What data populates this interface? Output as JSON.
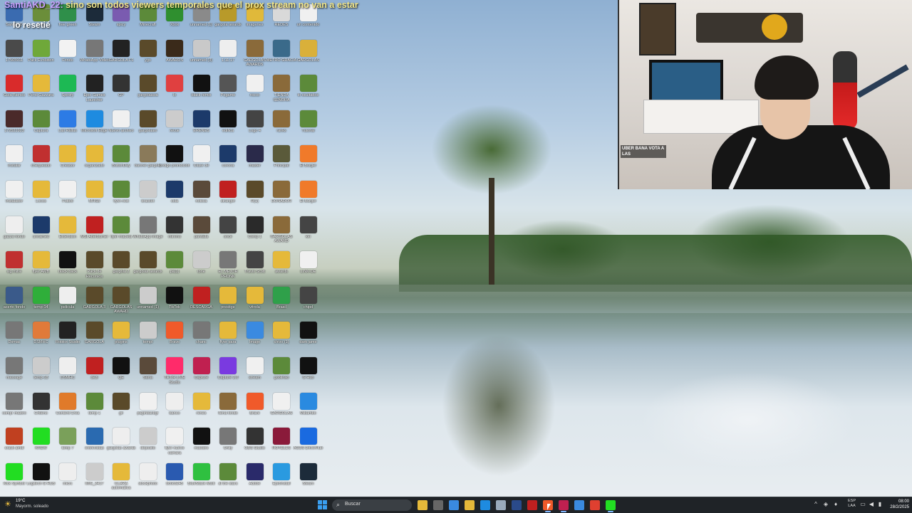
{
  "chat": {
    "line_user": "SantiAKD_22:",
    "line_text": "sino son todos viewers temporales que el prox stream no van a estar",
    "second_line": "lo resetié"
  },
  "desktop_icons": [
    {
      "label": "SantiAKD",
      "color": "#3a6bb0"
    },
    {
      "label": "Pack",
      "color": "#6b8e3a"
    },
    {
      "label": "free green",
      "color": "#2f8f4a"
    },
    {
      "label": "Steam",
      "color": "#1c2b3a"
    },
    {
      "label": "spicy",
      "color": "#7a5bb0"
    },
    {
      "label": "Minecraft",
      "color": "#5c8a3a"
    },
    {
      "label": "Xbox",
      "color": "#2f8f2f"
    },
    {
      "label": "unnamed (1)",
      "color": "#8a8a8a"
    },
    {
      "label": "gargola awards",
      "color": "#b89a2a"
    },
    {
      "label": "imagenes",
      "color": "#e0b93a"
    },
    {
      "label": "REDES",
      "color": "#d9d9d9"
    },
    {
      "label": "un contenido",
      "color": "#f0f0f0"
    },
    {
      "label": "17565911",
      "color": "#4a4a4a"
    },
    {
      "label": "Pack Evolution",
      "color": "#6fa83a"
    },
    {
      "label": "Fondo",
      "color": "#f2f2f2"
    },
    {
      "label": "WhatsApp Video",
      "color": "#777"
    },
    {
      "label": "GARGOLA F1",
      "color": "#222"
    },
    {
      "label": "ygo",
      "color": "#5a4a2a"
    },
    {
      "label": "AWARDS",
      "color": "#3a2a1a"
    },
    {
      "label": "unnamed (3)",
      "color": "#c9c9c9"
    },
    {
      "label": "1.11.17",
      "color": "#eee"
    },
    {
      "label": "GARGOLAS AWARDS",
      "color": "#8a6a3a"
    },
    {
      "label": "METRO GRACIA",
      "color": "#3a6a8a"
    },
    {
      "label": "GARGOLAS",
      "color": "#d9b03a"
    },
    {
      "label": "Guia Bienes",
      "color": "#d92b2b"
    },
    {
      "label": "Perdi Gazzara",
      "color": "#e5b93a"
    },
    {
      "label": "Spotify",
      "color": "#1db954"
    },
    {
      "label": "Epic Games Launcher",
      "color": "#222"
    },
    {
      "label": "GP",
      "color": "#333"
    },
    {
      "label": "gargolaawa",
      "color": "#5a4a2a"
    },
    {
      "label": "lo",
      "color": "#e04040"
    },
    {
      "label": "black remix",
      "color": "#111"
    },
    {
      "label": "Pegame",
      "color": "#555"
    },
    {
      "label": "rocco",
      "color": "#f0f0f0"
    },
    {
      "label": "TIENDA SEÑORA",
      "color": "#8a6a3a"
    },
    {
      "label": "lo ocultados",
      "color": "#5c8a3a"
    },
    {
      "label": "172521923",
      "color": "#4a2a2a"
    },
    {
      "label": "Captura",
      "color": "#5c8a3a"
    },
    {
      "label": "Las Rallas",
      "color": "#2c7be5"
    },
    {
      "label": "Microsoft Edge",
      "color": "#1e8be0"
    },
    {
      "label": "Nuevo archivo",
      "color": "#f0f0f0"
    },
    {
      "label": "gargolaaw",
      "color": "#5a4a2a"
    },
    {
      "label": "revue",
      "color": "#ccc"
    },
    {
      "label": "ERENES",
      "color": "#1c3a6a"
    },
    {
      "label": "edifica",
      "color": "#111"
    },
    {
      "label": "Logo 4",
      "color": "#444"
    },
    {
      "label": "ranks",
      "color": "#8a6a3a"
    },
    {
      "label": "Tutorial",
      "color": "#5c8a3a"
    },
    {
      "label": "Instalar",
      "color": "#f0f0f0"
    },
    {
      "label": "chequeado",
      "color": "#c03030"
    },
    {
      "label": "Creador",
      "color": "#e5b93a"
    },
    {
      "label": "organizado",
      "color": "#e5b93a"
    },
    {
      "label": "ButtonDay",
      "color": "#5c8a3a"
    },
    {
      "label": "banner gargola",
      "color": "#8a7a5a"
    },
    {
      "label": "codigo promocion",
      "color": "#111"
    },
    {
      "label": "Clase de",
      "color": "#f0f0f0"
    },
    {
      "label": "corona",
      "color": "#1c3a6a"
    },
    {
      "label": "master",
      "color": "#2a2a4a"
    },
    {
      "label": "Principal",
      "color": "#5a5a3a"
    },
    {
      "label": "El Burger",
      "color": "#f07a2a"
    },
    {
      "label": "Instalador",
      "color": "#f0f0f0"
    },
    {
      "label": "Locos",
      "color": "#e5b93a"
    },
    {
      "label": "Futbol",
      "color": "#f0f0f0"
    },
    {
      "label": "MHSB",
      "color": "#e5b93a"
    },
    {
      "label": "flyer-rest",
      "color": "#5c8a3a"
    },
    {
      "label": "bracket",
      "color": "#ccc"
    },
    {
      "label": "cola",
      "color": "#1c3a6a"
    },
    {
      "label": "noticia",
      "color": "#5a4a3a"
    },
    {
      "label": "stranger",
      "color": "#c02020"
    },
    {
      "label": "R(1)",
      "color": "#5a4a2a"
    },
    {
      "label": "DONADOR",
      "color": "#8a6a3a"
    },
    {
      "label": "El Burger",
      "color": "#f07a2a"
    },
    {
      "label": "gazza fondo",
      "color": "#eee"
    },
    {
      "label": "unnamed",
      "color": "#1c3a6a"
    },
    {
      "label": "Extension",
      "color": "#e5b93a"
    },
    {
      "label": "MSI Afterburner",
      "color": "#c02020"
    },
    {
      "label": "flyer maceta",
      "color": "#5c8a3a"
    },
    {
      "label": "WhatsApp Image",
      "color": "#777"
    },
    {
      "label": "mimmo",
      "color": "#333"
    },
    {
      "label": "pantalla",
      "color": "#5a4a3a"
    },
    {
      "label": "once",
      "color": "#444"
    },
    {
      "label": "Comp 1",
      "color": "#2a2a2a"
    },
    {
      "label": "GARGOLAS AWARD",
      "color": "#8a6a3a"
    },
    {
      "label": "kei",
      "color": "#444"
    },
    {
      "label": "sig mitre",
      "color": "#c03030"
    },
    {
      "label": "flyer AMB",
      "color": "#e5b93a"
    },
    {
      "label": "black back",
      "color": "#111"
    },
    {
      "label": "Pack de Recursos",
      "color": "#5a4a2a"
    },
    {
      "label": "gargola 2",
      "color": "#5a4a2a"
    },
    {
      "label": "gargolas awards",
      "color": "#5a4a2a"
    },
    {
      "label": "pa(1)",
      "color": "#5c8a3a"
    },
    {
      "label": "tone",
      "color": "#ccc"
    },
    {
      "label": "EL MEJOR PHONK",
      "color": "#777"
    },
    {
      "label": "Travis Scott",
      "color": "#444"
    },
    {
      "label": "awards",
      "color": "#e5b93a"
    },
    {
      "label": "LINK-DE",
      "color": "#f0f0f0"
    },
    {
      "label": "acerto fondo",
      "color": "#3a5a8a"
    },
    {
      "label": "temp-14",
      "color": "#2fae3a"
    },
    {
      "label": "pelicula",
      "color": "#eee"
    },
    {
      "label": "GARGOLA 3",
      "color": "#5a4a2a"
    },
    {
      "label": "GARGOLAS AWARD",
      "color": "#5a4a2a"
    },
    {
      "label": "unnamed (1)",
      "color": "#ccc"
    },
    {
      "label": "TikTok",
      "color": "#111"
    },
    {
      "label": "DESCARGA",
      "color": "#c02020"
    },
    {
      "label": "prestige",
      "color": "#e5b93a"
    },
    {
      "label": "vitrola",
      "color": "#e5b93a"
    },
    {
      "label": "Brasil",
      "color": "#2fa04a"
    },
    {
      "label": "chipd",
      "color": "#444"
    },
    {
      "label": "Dsmac",
      "color": "#777"
    },
    {
      "label": "DSMHC",
      "color": "#e07a3a"
    },
    {
      "label": "Roblox Studio",
      "color": "#222"
    },
    {
      "label": "GARGOLA",
      "color": "#5a4a2a"
    },
    {
      "label": "plugins",
      "color": "#e5b93a"
    },
    {
      "label": "templ",
      "color": "#ccc"
    },
    {
      "label": "Brave",
      "color": "#f05a2a"
    },
    {
      "label": "chanc",
      "color": "#777"
    },
    {
      "label": "flyer para",
      "color": "#e5b93a"
    },
    {
      "label": "Image",
      "color": "#3a8ae0"
    },
    {
      "label": "chivo (1)",
      "color": "#e5b93a"
    },
    {
      "label": "dark jame",
      "color": "#111"
    },
    {
      "label": "massage",
      "color": "#777"
    },
    {
      "label": "temp-18",
      "color": "#ccc"
    },
    {
      "label": "DSMHC",
      "color": "#eee"
    },
    {
      "label": "dezi",
      "color": "#c02020"
    },
    {
      "label": "QE",
      "color": "#111"
    },
    {
      "label": "Sarta",
      "color": "#5a4a3a"
    },
    {
      "label": "TikTok LIVE Studio",
      "color": "#ff2b6a"
    },
    {
      "label": "Capture",
      "color": "#c02050"
    },
    {
      "label": "Capture 2.0",
      "color": "#7a3ae0"
    },
    {
      "label": "stream",
      "color": "#f0f0f0"
    },
    {
      "label": "goblinao",
      "color": "#5c8a3a"
    },
    {
      "label": "G Hub",
      "color": "#111"
    },
    {
      "label": "compr mastro",
      "color": "#777"
    },
    {
      "label": "Chileno",
      "color": "#333"
    },
    {
      "label": "Content Crea",
      "color": "#e07a2a"
    },
    {
      "label": "temp 1",
      "color": "#5c8a3a"
    },
    {
      "label": "gir",
      "color": "#5a4a2a"
    },
    {
      "label": "paginbackgr",
      "color": "#f0f0f0"
    },
    {
      "label": "banco",
      "color": "#eee"
    },
    {
      "label": "renes",
      "color": "#e5b93a"
    },
    {
      "label": "llena fondo",
      "color": "#8a6a3a"
    },
    {
      "label": "Brave",
      "color": "#f05a2a"
    },
    {
      "label": "GARGOLAS",
      "color": "#f0f0f0"
    },
    {
      "label": "Mibambo",
      "color": "#2a8ae0"
    },
    {
      "label": "crack amdl",
      "color": "#c04020"
    },
    {
      "label": "KREW",
      "color": "#22dd22"
    },
    {
      "label": "temp 7",
      "color": "#7aa05a"
    },
    {
      "label": "entrevistas",
      "color": "#2a6ab0"
    },
    {
      "label": "gargolas awards",
      "color": "#eee"
    },
    {
      "label": "deposito",
      "color": "#ccc"
    },
    {
      "label": "flyer nuevo camara",
      "color": "#f0f0f0"
    },
    {
      "label": "maestro",
      "color": "#111"
    },
    {
      "label": "Unity",
      "color": "#777"
    },
    {
      "label": "OBS Studio",
      "color": "#333"
    },
    {
      "label": "HOTELES",
      "color": "#8a1a3a"
    },
    {
      "label": "ASUS DriverHub",
      "color": "#1a6ae0"
    },
    {
      "label": "Kick Symbol",
      "color": "#22dd22"
    },
    {
      "label": "Logitech G HUB",
      "color": "#111"
    },
    {
      "label": "micrc",
      "color": "#eee"
    },
    {
      "label": "IMG_2417",
      "color": "#ccc"
    },
    {
      "label": "CLARA automatica",
      "color": "#e5b93a"
    },
    {
      "label": "stockphoto",
      "color": "#eee"
    },
    {
      "label": "bc6c6245",
      "color": "#2a5ab0"
    },
    {
      "label": "BlueStack Multi",
      "color": "#2fc040"
    },
    {
      "label": "al the stars",
      "color": "#5c8a3a"
    },
    {
      "label": "Adobe",
      "color": "#2a2a6a"
    },
    {
      "label": "EpicInstall",
      "color": "#2a9ae0"
    },
    {
      "label": "Steam",
      "color": "#1c2b3a"
    }
  ],
  "webcam": {
    "chat_text": "UBER BANA VOTA A LAS"
  },
  "taskbar": {
    "weather_temp": "19°C",
    "weather_desc": "Mayorm. soleado",
    "search_label": "Buscar",
    "lang_line1": "ESP",
    "lang_line2": "LAA",
    "time": "08:00",
    "date": "28/2/2025",
    "apps": [
      {
        "name": "file-explorer",
        "color": "#e5b93a",
        "active": false
      },
      {
        "name": "app-1",
        "color": "#666",
        "active": false
      },
      {
        "name": "microsoft-store",
        "color": "#3a8ae0",
        "active": false
      },
      {
        "name": "folder",
        "color": "#e5b93a",
        "active": false
      },
      {
        "name": "edge",
        "color": "#1e8be0",
        "active": false
      },
      {
        "name": "notepad",
        "color": "#9ab",
        "active": false
      },
      {
        "name": "pro",
        "color": "#2a4a8a",
        "active": false
      },
      {
        "name": "msi",
        "color": "#c02020",
        "active": false
      },
      {
        "name": "brave",
        "color": "#f05a2a",
        "active": true
      },
      {
        "name": "obs",
        "color": "#c02050",
        "active": true
      },
      {
        "name": "notepad-2",
        "color": "#3a8ae0",
        "active": false
      },
      {
        "name": "chrome",
        "color": "#e04030",
        "active": false
      },
      {
        "name": "kick",
        "color": "#22dd22",
        "active": true
      }
    ]
  },
  "colors": {
    "taskbar_bg": "#1f2327",
    "chat_user": "#c8a2ff",
    "chat_text": "#f0e68c"
  }
}
